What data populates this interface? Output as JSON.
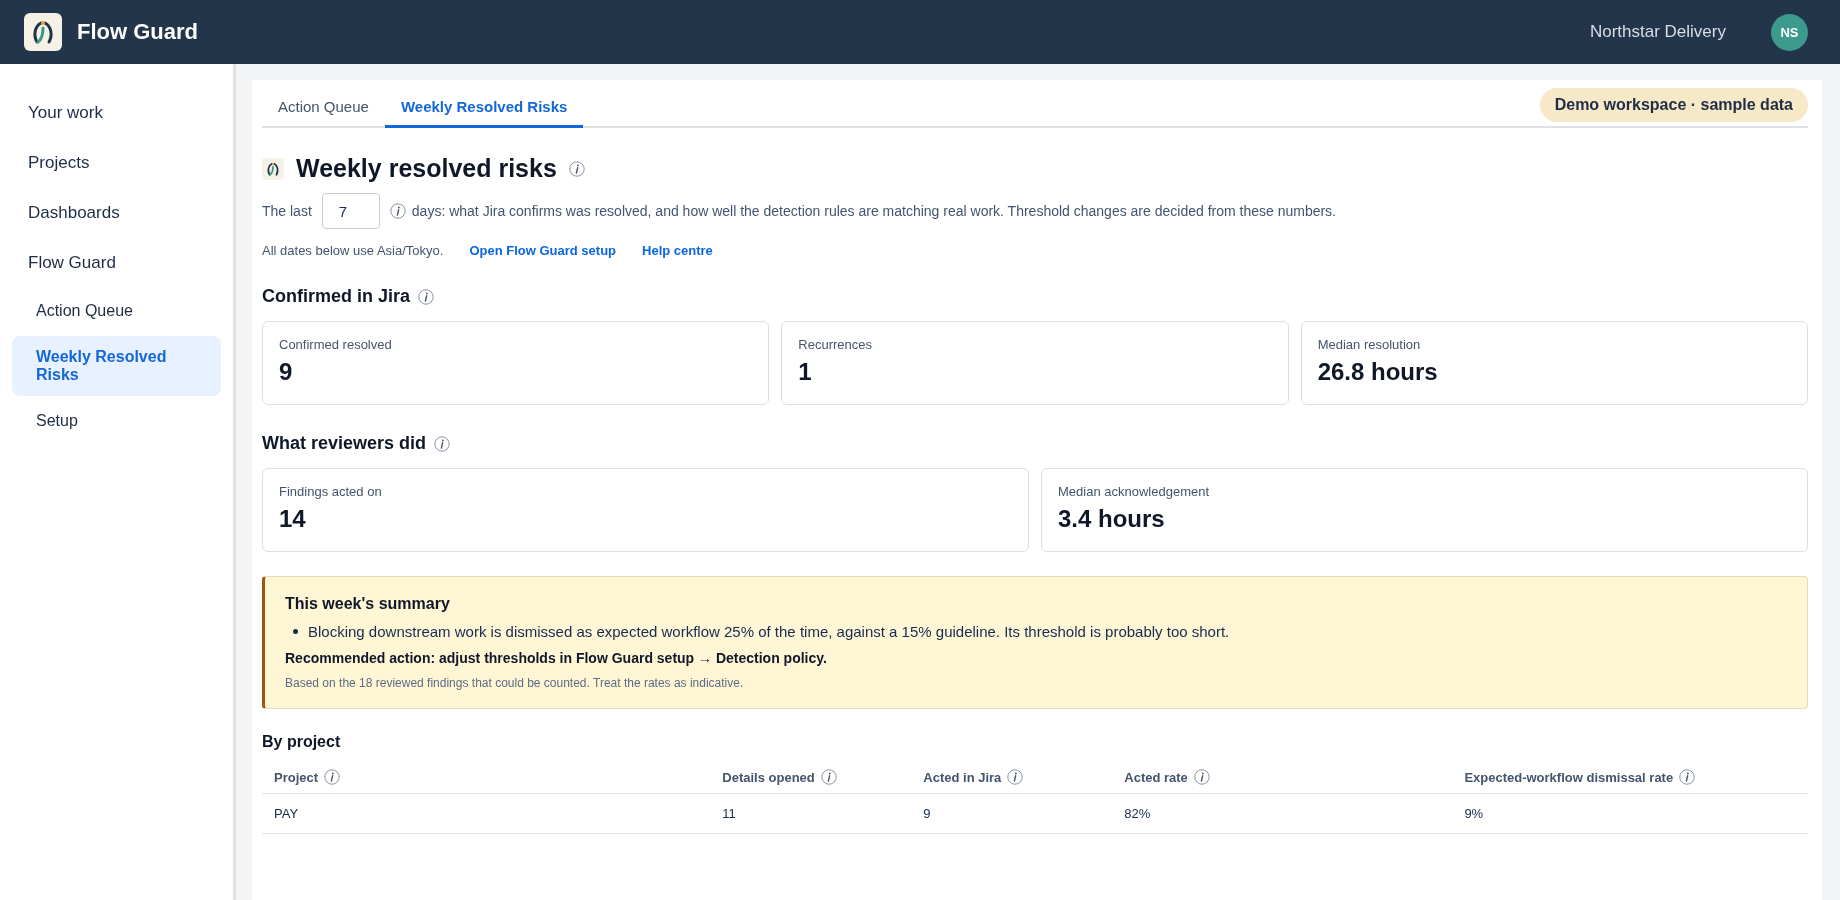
{
  "header": {
    "app_name": "Flow Guard",
    "workspace": "Northstar Delivery",
    "avatar_initials": "NS"
  },
  "sidebar": {
    "items": [
      {
        "label": "Your work",
        "selected": false
      },
      {
        "label": "Projects",
        "selected": false
      },
      {
        "label": "Dashboards",
        "selected": false
      },
      {
        "label": "Flow Guard",
        "selected": false,
        "children": [
          {
            "label": "Action Queue",
            "selected": false
          },
          {
            "label": "Weekly Resolved Risks",
            "selected": true
          },
          {
            "label": "Setup",
            "selected": false
          }
        ]
      }
    ]
  },
  "tabs": [
    {
      "label": "Action Queue",
      "selected": false
    },
    {
      "label": "Weekly Resolved Risks",
      "selected": true
    }
  ],
  "badge": "Demo workspace · sample data",
  "page": {
    "title": "Weekly resolved risks",
    "intro_before": "The last",
    "days": "7",
    "intro_after": "days: what Jira confirms was resolved, and how well the detection rules are matching real work. Threshold changes are decided from these numbers.",
    "timezone_note": "All dates below use Asia/Tokyo.",
    "links": [
      "Open Flow Guard setup",
      "Help centre"
    ]
  },
  "sections": [
    {
      "title": "Confirmed in Jira",
      "metrics": [
        {
          "label": "Confirmed resolved",
          "value": "9"
        },
        {
          "label": "Recurrences",
          "value": "1"
        },
        {
          "label": "Median resolution",
          "value": "26.8 hours"
        }
      ]
    },
    {
      "title": "What reviewers did",
      "metrics": [
        {
          "label": "Findings acted on",
          "value": "14"
        },
        {
          "label": "Median acknowledgement",
          "value": "3.4 hours"
        }
      ]
    }
  ],
  "summary": {
    "title": "This week's summary",
    "bullets": [
      "Blocking downstream work is dismissed as expected workflow 25% of the time, against a 15% guideline. Its threshold is probably too short."
    ],
    "action": "Recommended action: adjust thresholds in Flow Guard setup → Detection policy.",
    "note": "Based on the 18 reviewed findings that could be counted. Treat the rates as indicative."
  },
  "table": {
    "title": "By project",
    "columns": [
      "Project",
      "Details opened",
      "Acted in Jira",
      "Acted rate",
      "Expected-workflow dismissal rate"
    ],
    "rows": [
      [
        "PAY",
        "11",
        "9",
        "82%",
        "9%"
      ]
    ]
  }
}
